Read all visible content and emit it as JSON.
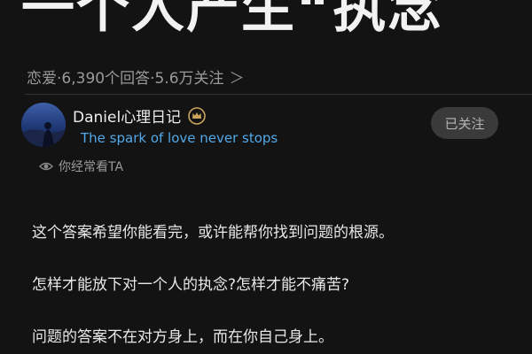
{
  "question": {
    "title": "一个人产生“执念",
    "meta_text": "恋爱·6,390个回答·5.6万关注",
    "meta_chevron": "＞"
  },
  "author": {
    "name": "Daniel心理日记",
    "bio": "The spark of love never stops",
    "badge_icon": "crown-badge-icon",
    "follow_label": "已关注",
    "seen_text": "你经常看TA"
  },
  "answer": {
    "paragraphs": [
      "这个答案希望你能看完，或许能帮你找到问题的根源。",
      "怎样才能放下对一个人的执念?怎样才能不痛苦?",
      "问题的答案不在对方身上，而在你自己身上。"
    ]
  },
  "colors": {
    "background": "#131313",
    "bio_link": "#52a8e8",
    "follow_button_bg": "#3a3a3a",
    "badge_gold": "#c9a45a"
  }
}
